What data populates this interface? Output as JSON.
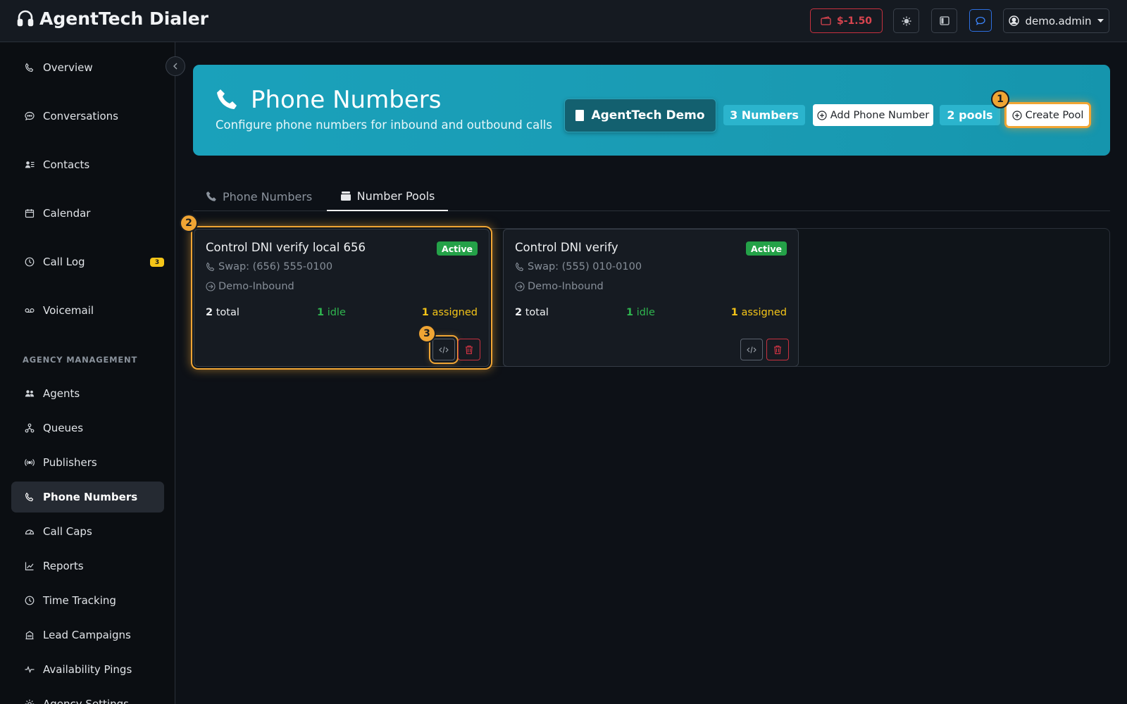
{
  "app": {
    "title": "AgentTech Dialer",
    "balance": "$-1.50",
    "user": "demo.admin"
  },
  "sidebar": {
    "items": [
      {
        "label": "Overview",
        "icon": "phone-icon"
      },
      {
        "label": "Conversations",
        "icon": "chat-bubble-icon"
      },
      {
        "label": "Contacts",
        "icon": "contact-card-icon"
      },
      {
        "label": "Calendar",
        "icon": "calendar-icon"
      },
      {
        "label": "Call Log",
        "icon": "clock-icon",
        "badge": "3"
      },
      {
        "label": "Voicemail",
        "icon": "voicemail-icon"
      }
    ],
    "section_label": "AGENCY MANAGEMENT",
    "agency_items": [
      {
        "label": "Agents",
        "icon": "people-icon"
      },
      {
        "label": "Queues",
        "icon": "diagram-icon"
      },
      {
        "label": "Publishers",
        "icon": "broadcast-icon"
      },
      {
        "label": "Phone Numbers",
        "icon": "phone-icon",
        "active": true
      },
      {
        "label": "Call Caps",
        "icon": "speedometer-icon"
      },
      {
        "label": "Reports",
        "icon": "line-chart-icon"
      },
      {
        "label": "Time Tracking",
        "icon": "clock-icon"
      },
      {
        "label": "Lead Campaigns",
        "icon": "building-icon"
      },
      {
        "label": "Availability Pings",
        "icon": "pulse-icon"
      },
      {
        "label": "Agency Settings",
        "icon": "gear-icon"
      }
    ]
  },
  "hero": {
    "title": "Phone Numbers",
    "subtitle": "Configure phone numbers for inbound and outbound calls",
    "org": "AgentTech Demo",
    "numbers_count": "3 Numbers",
    "add_number": "Add Phone Number",
    "pools_count": "2 pools",
    "create_pool": "Create Pool"
  },
  "tabs": [
    {
      "label": "Phone Numbers",
      "active": false
    },
    {
      "label": "Number Pools",
      "active": true
    }
  ],
  "pools": [
    {
      "name": "Control DNI verify local 656",
      "status": "Active",
      "swap": "Swap: (656) 555-0100",
      "route": "Demo-Inbound",
      "total": "2",
      "total_label": "total",
      "idle": "1",
      "idle_label": "idle",
      "assigned": "1",
      "assigned_label": "assigned"
    },
    {
      "name": "Control DNI verify",
      "status": "Active",
      "swap": "Swap: (555) 010-0100",
      "route": "Demo-Inbound",
      "total": "2",
      "total_label": "total",
      "idle": "1",
      "idle_label": "idle",
      "assigned": "1",
      "assigned_label": "assigned"
    }
  ],
  "markers": [
    "1",
    "2",
    "3"
  ],
  "colors": {
    "accent": "#1aa1bb",
    "highlight": "#f0a534",
    "active_badge": "#24a148",
    "idle": "#2fb54f",
    "assigned": "#f5c518",
    "danger": "#dc3545"
  }
}
